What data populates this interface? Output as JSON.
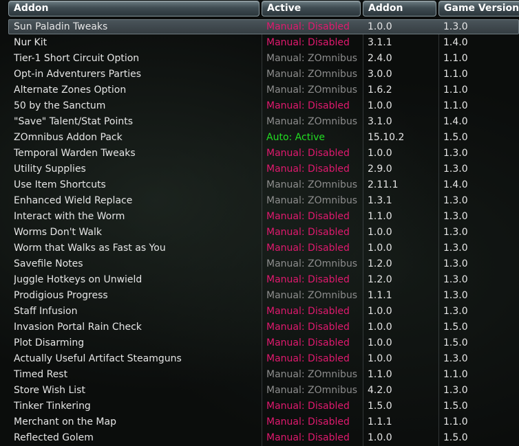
{
  "header": {
    "col_name": "Addon",
    "col_active": "Active",
    "col_addon_version": "Addon",
    "col_game_version": "Game Version"
  },
  "colors": {
    "disabled": "#e0196e",
    "omnibus": "#8d8d8d",
    "active": "#22dd22"
  },
  "rows": [
    {
      "name": "Sun Paladin Tweaks",
      "status": "Manual: Disabled",
      "kind": "disabled",
      "addon_version": "1.0.0",
      "game_version": "1.3.0",
      "selected": true
    },
    {
      "name": "Nur Kit",
      "status": "Manual: Disabled",
      "kind": "disabled",
      "addon_version": "3.1.1",
      "game_version": "1.4.0"
    },
    {
      "name": "Tier-1 Short Circuit Option",
      "status": "Manual: ZOmnibus",
      "kind": "omnibus",
      "addon_version": "2.4.0",
      "game_version": "1.1.0"
    },
    {
      "name": "Opt-in Adventurers Parties",
      "status": "Manual: ZOmnibus",
      "kind": "omnibus",
      "addon_version": "3.0.0",
      "game_version": "1.1.0"
    },
    {
      "name": "Alternate Zones Option",
      "status": "Manual: ZOmnibus",
      "kind": "omnibus",
      "addon_version": "1.6.2",
      "game_version": "1.1.0"
    },
    {
      "name": "50 by the Sanctum",
      "status": "Manual: Disabled",
      "kind": "disabled",
      "addon_version": "1.0.0",
      "game_version": "1.1.0"
    },
    {
      "name": "\"Save\" Talent/Stat Points",
      "status": "Manual: ZOmnibus",
      "kind": "omnibus",
      "addon_version": "3.1.0",
      "game_version": "1.4.0"
    },
    {
      "name": "ZOmnibus Addon Pack",
      "status": "Auto: Active",
      "kind": "active",
      "addon_version": "15.10.2",
      "game_version": "1.5.0"
    },
    {
      "name": "Temporal Warden Tweaks",
      "status": "Manual: Disabled",
      "kind": "disabled",
      "addon_version": "1.0.0",
      "game_version": "1.3.0"
    },
    {
      "name": "Utility Supplies",
      "status": "Manual: Disabled",
      "kind": "disabled",
      "addon_version": "2.9.0",
      "game_version": "1.3.0"
    },
    {
      "name": "Use Item Shortcuts",
      "status": "Manual: ZOmnibus",
      "kind": "omnibus",
      "addon_version": "2.11.1",
      "game_version": "1.4.0"
    },
    {
      "name": "Enhanced Wield Replace",
      "status": "Manual: ZOmnibus",
      "kind": "omnibus",
      "addon_version": "1.3.1",
      "game_version": "1.3.0"
    },
    {
      "name": "Interact with the Worm",
      "status": "Manual: Disabled",
      "kind": "disabled",
      "addon_version": "1.1.0",
      "game_version": "1.3.0"
    },
    {
      "name": "Worms Don't Walk",
      "status": "Manual: Disabled",
      "kind": "disabled",
      "addon_version": "1.0.0",
      "game_version": "1.3.0"
    },
    {
      "name": "Worm that Walks as Fast as You",
      "status": "Manual: Disabled",
      "kind": "disabled",
      "addon_version": "1.0.0",
      "game_version": "1.3.0"
    },
    {
      "name": "Savefile Notes",
      "status": "Manual: ZOmnibus",
      "kind": "omnibus",
      "addon_version": "1.2.0",
      "game_version": "1.3.0"
    },
    {
      "name": "Juggle Hotkeys on Unwield",
      "status": "Manual: Disabled",
      "kind": "disabled",
      "addon_version": "1.2.0",
      "game_version": "1.3.0"
    },
    {
      "name": "Prodigious Progress",
      "status": "Manual: ZOmnibus",
      "kind": "omnibus",
      "addon_version": "1.1.1",
      "game_version": "1.3.0"
    },
    {
      "name": "Staff Infusion",
      "status": "Manual: Disabled",
      "kind": "disabled",
      "addon_version": "1.0.0",
      "game_version": "1.3.0"
    },
    {
      "name": "Invasion Portal Rain Check",
      "status": "Manual: Disabled",
      "kind": "disabled",
      "addon_version": "1.0.0",
      "game_version": "1.5.0"
    },
    {
      "name": "Plot Disarming",
      "status": "Manual: Disabled",
      "kind": "disabled",
      "addon_version": "1.0.0",
      "game_version": "1.5.0"
    },
    {
      "name": "Actually Useful Artifact Steamguns",
      "status": "Manual: Disabled",
      "kind": "disabled",
      "addon_version": "1.0.0",
      "game_version": "1.3.0"
    },
    {
      "name": "Timed Rest",
      "status": "Manual: ZOmnibus",
      "kind": "omnibus",
      "addon_version": "1.1.0",
      "game_version": "1.1.0"
    },
    {
      "name": "Store Wish List",
      "status": "Manual: ZOmnibus",
      "kind": "omnibus",
      "addon_version": "4.2.0",
      "game_version": "1.3.0"
    },
    {
      "name": "Tinker Tinkering",
      "status": "Manual: Disabled",
      "kind": "disabled",
      "addon_version": "1.5.0",
      "game_version": "1.5.0"
    },
    {
      "name": "Merchant on the Map",
      "status": "Manual: Disabled",
      "kind": "disabled",
      "addon_version": "1.1.1",
      "game_version": "1.1.0"
    },
    {
      "name": "Reflected Golem",
      "status": "Manual: Disabled",
      "kind": "disabled",
      "addon_version": "1.0.0",
      "game_version": "1.5.0"
    }
  ]
}
